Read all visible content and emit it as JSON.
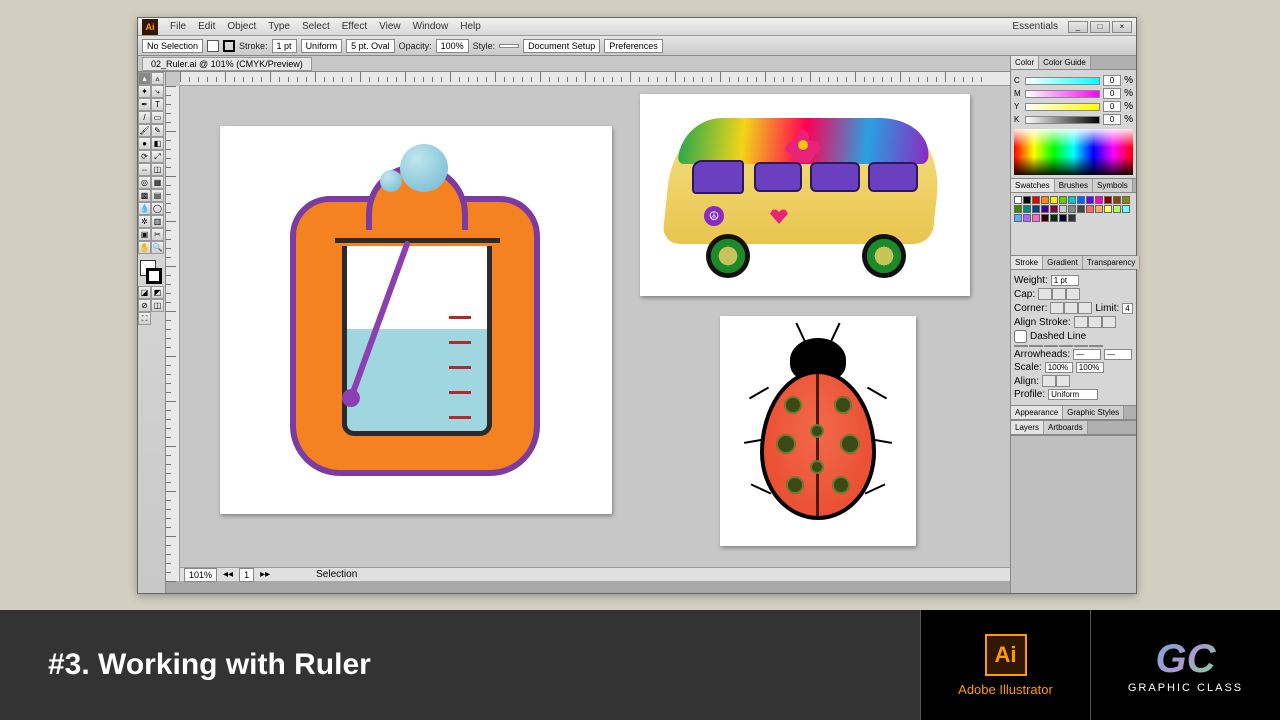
{
  "menubar": {
    "items": [
      "File",
      "Edit",
      "Object",
      "Type",
      "Select",
      "Effect",
      "View",
      "Window",
      "Help"
    ],
    "workspace": "Essentials"
  },
  "controlbar": {
    "selection": "No Selection",
    "stroke_lbl": "Stroke:",
    "stroke_val": "1 pt",
    "uniform": "Uniform",
    "brush": "5 pt. Oval",
    "opacity_lbl": "Opacity:",
    "opacity_val": "100%",
    "style_lbl": "Style:",
    "doc_setup": "Document Setup",
    "prefs": "Preferences"
  },
  "tab": {
    "name": "02_Ruler.ai @ 101% (CMYK/Preview)"
  },
  "status": {
    "zoom": "101%",
    "artboard_nav": "1",
    "sel": "Selection"
  },
  "panels": {
    "color": {
      "tab1": "Color",
      "tab2": "Color Guide",
      "c": "C",
      "m": "M",
      "y": "Y",
      "k": "K",
      "c_val": "0",
      "m_val": "0",
      "y_val": "0",
      "k_val": "0",
      "pct": "%"
    },
    "swatches": {
      "tab1": "Swatches",
      "tab2": "Brushes",
      "tab3": "Symbols"
    },
    "stroke": {
      "tab1": "Stroke",
      "tab2": "Gradient",
      "tab3": "Transparency",
      "weight_lbl": "Weight:",
      "weight_val": "1 pt",
      "cap_lbl": "Cap:",
      "corner_lbl": "Corner:",
      "limit_lbl": "Limit:",
      "limit_val": "4",
      "align_lbl": "Align Stroke:",
      "dashed": "Dashed Line",
      "arrow_lbl": "Arrowheads:",
      "scale_lbl": "Scale:",
      "scale1": "100%",
      "scale2": "100%",
      "align2": "Align:",
      "profile_lbl": "Profile:",
      "profile_val": "Uniform"
    },
    "appearance": {
      "tab1": "Appearance",
      "tab2": "Graphic Styles"
    },
    "layers": {
      "tab1": "Layers",
      "tab2": "Artboards"
    }
  },
  "banner": {
    "title": "#3. Working with Ruler",
    "ai": "Ai",
    "ai_label": "Adobe Illustrator",
    "gc": "GC",
    "gc_label": "GRAPHIC CLASS"
  }
}
